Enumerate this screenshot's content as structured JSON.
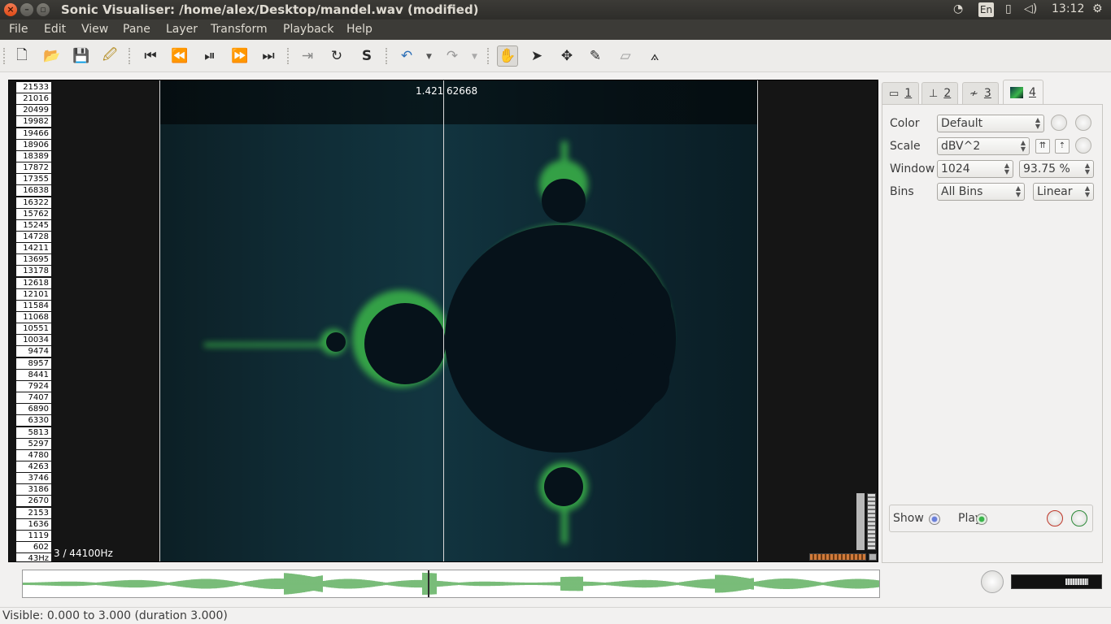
{
  "window": {
    "title": "Sonic Visualiser: /home/alex/Desktop/mandel.wav (modified)"
  },
  "tray": {
    "lang": "En",
    "time": "13:12"
  },
  "menu": [
    "File",
    "Edit",
    "View",
    "Pane",
    "Layer",
    "Transform",
    "Playback",
    "Help"
  ],
  "toolbar": {
    "icons": [
      "new-document-icon",
      "open-folder-icon",
      "save-icon",
      "save-as-icon",
      "rewind-start-icon",
      "rewind-icon",
      "play-pause-icon",
      "fast-forward-icon",
      "fast-forward-end-icon",
      "constrain-playback-icon",
      "loop-icon",
      "solo-icon",
      "undo-icon",
      "redo-icon",
      "navigate-tool-icon",
      "select-tool-icon",
      "move-tool-icon",
      "draw-tool-icon",
      "erase-tool-icon",
      "measure-tool-icon"
    ]
  },
  "scale": {
    "labels": [
      "21533",
      "21016",
      "20499",
      "19982",
      "19466",
      "18906",
      "18389",
      "17872",
      "17355",
      "16838",
      "16322",
      "15762",
      "15245",
      "14728",
      "14211",
      "13695",
      "13178",
      "12618",
      "12101",
      "11584",
      "11068",
      "10551",
      "10034",
      "9474",
      "8957",
      "8441",
      "7924",
      "7407",
      "6890",
      "6330",
      "5813",
      "5297",
      "4780",
      "4263",
      "3746",
      "3186",
      "2670",
      "2153",
      "1636",
      "1119",
      "602",
      "43Hz"
    ]
  },
  "pane": {
    "time_label": "1.421",
    "frame_label": "62668",
    "rate_label": "3 / 44100Hz"
  },
  "tabs": [
    {
      "num": "1",
      "icon": "pane-icon"
    },
    {
      "num": "2",
      "icon": "ruler-icon"
    },
    {
      "num": "3",
      "icon": "waveform-icon"
    },
    {
      "num": "4",
      "icon": "spectrogram-icon"
    }
  ],
  "props": {
    "color_label": "Color",
    "color_value": "Default",
    "scale_label": "Scale",
    "scale_value": "dBV^2",
    "window_label": "Window",
    "window_value": "1024",
    "overlap_value": "93.75 %",
    "bins_label": "Bins",
    "bins_value": "All Bins",
    "bins_scale_value": "Linear",
    "show_label": "Show",
    "play_label": "Play"
  },
  "status": {
    "text": "Visible: 0.000 to 3.000 (duration 3.000)"
  },
  "colors": {
    "accent_green": "#3ab54a",
    "spectrogram_bg": "#123540",
    "title_bar": "#3c3b37"
  }
}
